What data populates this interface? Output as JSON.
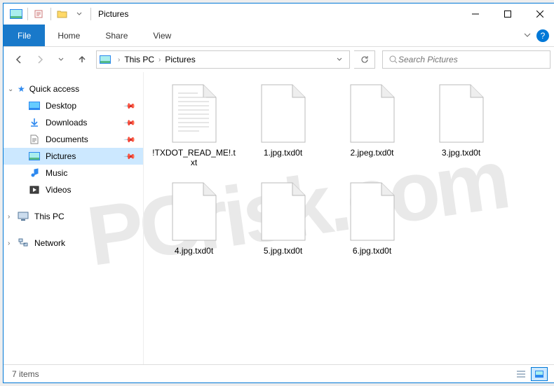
{
  "window": {
    "title": "Pictures"
  },
  "ribbon": {
    "file": "File",
    "tabs": [
      "Home",
      "Share",
      "View"
    ]
  },
  "breadcrumb": {
    "items": [
      "This PC",
      "Pictures"
    ]
  },
  "search": {
    "placeholder": "Search Pictures"
  },
  "nav": {
    "quickaccess": {
      "label": "Quick access",
      "items": [
        {
          "label": "Desktop",
          "icon": "desktop-icon",
          "pinned": true
        },
        {
          "label": "Downloads",
          "icon": "downloads-icon",
          "pinned": true
        },
        {
          "label": "Documents",
          "icon": "documents-icon",
          "pinned": true
        },
        {
          "label": "Pictures",
          "icon": "pictures-icon",
          "pinned": true,
          "selected": true
        },
        {
          "label": "Music",
          "icon": "music-icon"
        },
        {
          "label": "Videos",
          "icon": "videos-icon"
        }
      ]
    },
    "thispc": {
      "label": "This PC"
    },
    "network": {
      "label": "Network"
    }
  },
  "files": [
    {
      "name": "!TXDOT_READ_ME!.txt",
      "type": "text"
    },
    {
      "name": "1.jpg.txd0t",
      "type": "blank"
    },
    {
      "name": "2.jpeg.txd0t",
      "type": "blank"
    },
    {
      "name": "3.jpg.txd0t",
      "type": "blank"
    },
    {
      "name": "4.jpg.txd0t",
      "type": "blank"
    },
    {
      "name": "5.jpg.txd0t",
      "type": "blank"
    },
    {
      "name": "6.jpg.txd0t",
      "type": "blank"
    }
  ],
  "status": {
    "count": "7 items"
  }
}
